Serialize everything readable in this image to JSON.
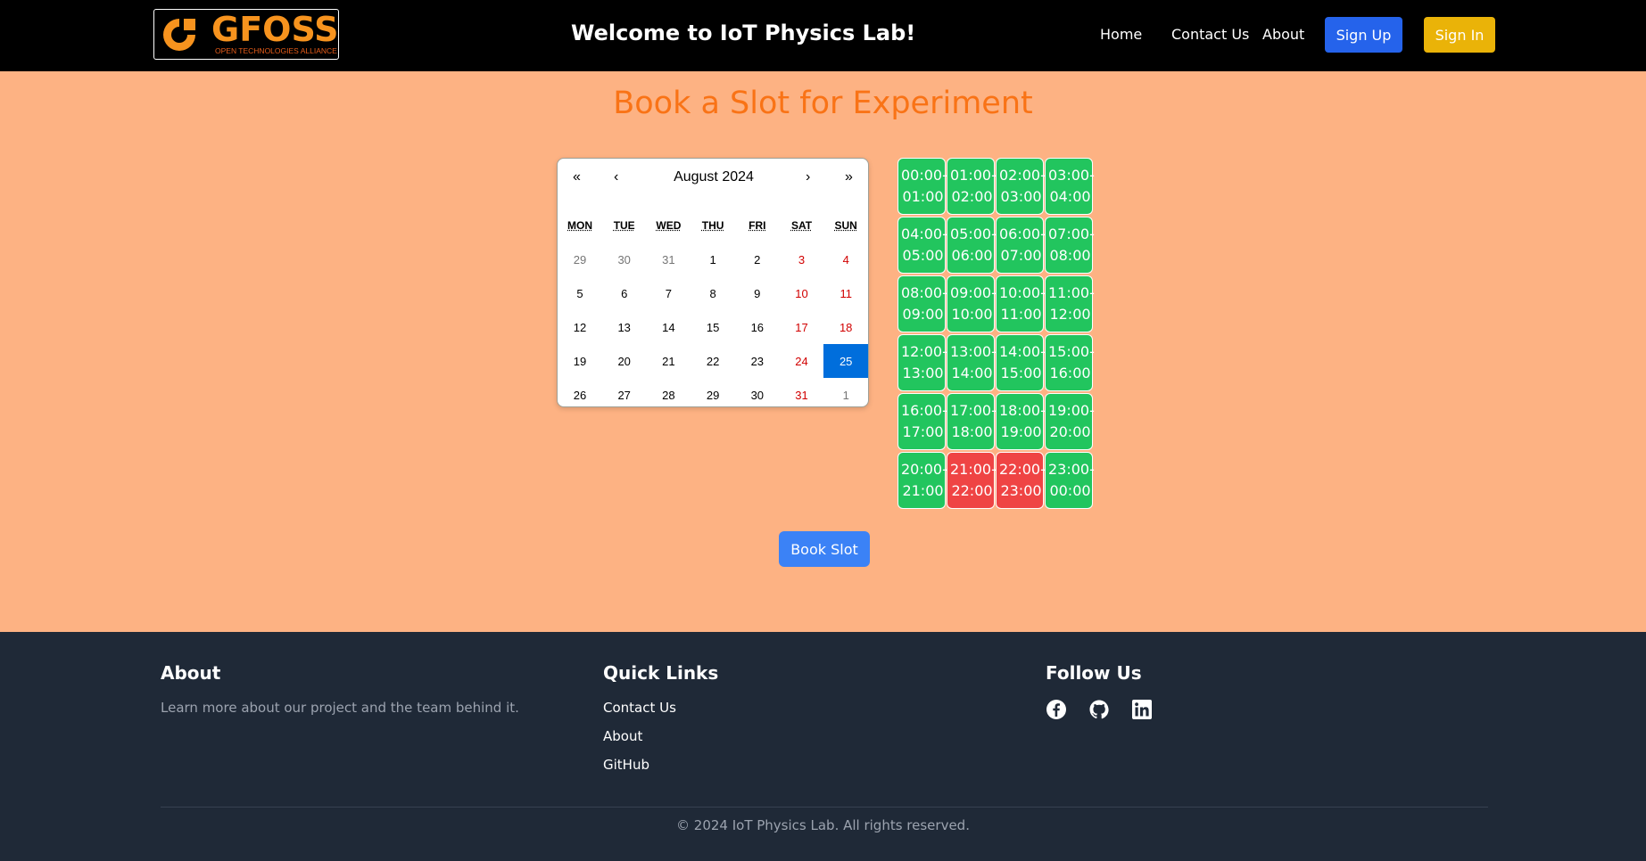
{
  "header": {
    "logo_text": "GFOSS",
    "logo_subtext": "OPEN TECHNOLOGIES ALLIANCE",
    "title": "Welcome to IoT Physics Lab!",
    "nav": [
      "Home",
      "Contact Us",
      "About"
    ],
    "signup_label": "Sign Up",
    "signin_label": "Sign In"
  },
  "page_title": "Book a Slot for Experiment",
  "calendar": {
    "prev2": "«",
    "prev": "‹",
    "month_label": "August 2024",
    "next": "›",
    "next2": "»",
    "weekdays": [
      "MON",
      "TUE",
      "WED",
      "THU",
      "FRI",
      "SAT",
      "SUN"
    ],
    "selected_day": "25",
    "weeks": [
      [
        "29",
        "30",
        "31",
        "1",
        "2",
        "3",
        "4"
      ],
      [
        "5",
        "6",
        "7",
        "8",
        "9",
        "10",
        "11"
      ],
      [
        "12",
        "13",
        "14",
        "15",
        "16",
        "17",
        "18"
      ],
      [
        "19",
        "20",
        "21",
        "22",
        "23",
        "24",
        "25"
      ],
      [
        "26",
        "27",
        "28",
        "29",
        "30",
        "31",
        "1"
      ]
    ]
  },
  "slots": [
    {
      "start": "00:00-",
      "end": "01:00",
      "status": "available"
    },
    {
      "start": "01:00-",
      "end": "02:00",
      "status": "available"
    },
    {
      "start": "02:00-",
      "end": "03:00",
      "status": "available"
    },
    {
      "start": "03:00-",
      "end": "04:00",
      "status": "available"
    },
    {
      "start": "04:00-",
      "end": "05:00",
      "status": "available"
    },
    {
      "start": "05:00-",
      "end": "06:00",
      "status": "available"
    },
    {
      "start": "06:00-",
      "end": "07:00",
      "status": "available"
    },
    {
      "start": "07:00-",
      "end": "08:00",
      "status": "available"
    },
    {
      "start": "08:00-",
      "end": "09:00",
      "status": "available"
    },
    {
      "start": "09:00-",
      "end": "10:00",
      "status": "available"
    },
    {
      "start": "10:00-",
      "end": "11:00",
      "status": "available"
    },
    {
      "start": "11:00-",
      "end": "12:00",
      "status": "available"
    },
    {
      "start": "12:00-",
      "end": "13:00",
      "status": "available"
    },
    {
      "start": "13:00-",
      "end": "14:00",
      "status": "available"
    },
    {
      "start": "14:00-",
      "end": "15:00",
      "status": "available"
    },
    {
      "start": "15:00-",
      "end": "16:00",
      "status": "available"
    },
    {
      "start": "16:00-",
      "end": "17:00",
      "status": "available"
    },
    {
      "start": "17:00-",
      "end": "18:00",
      "status": "available"
    },
    {
      "start": "18:00-",
      "end": "19:00",
      "status": "available"
    },
    {
      "start": "19:00-",
      "end": "20:00",
      "status": "available"
    },
    {
      "start": "20:00-",
      "end": "21:00",
      "status": "available"
    },
    {
      "start": "21:00-",
      "end": "22:00",
      "status": "booked"
    },
    {
      "start": "22:00-",
      "end": "23:00",
      "status": "booked"
    },
    {
      "start": "23:00-",
      "end": "00:00",
      "status": "available"
    }
  ],
  "book_button": "Book Slot",
  "footer": {
    "about_heading": "About",
    "about_text": "Learn more about our project and the team behind it.",
    "links_heading": "Quick Links",
    "links": [
      "Contact Us",
      "About",
      "GitHub"
    ],
    "follow_heading": "Follow Us",
    "social_icons": [
      "facebook-icon",
      "github-icon",
      "linkedin-icon"
    ],
    "copyright": "© 2024 IoT Physics Lab. All rights reserved."
  },
  "colors": {
    "page_bg": "#fdb283",
    "accent": "#f97316",
    "slot_available": "#22c55e",
    "slot_booked": "#ef4444",
    "selected_day": "#006edc"
  }
}
